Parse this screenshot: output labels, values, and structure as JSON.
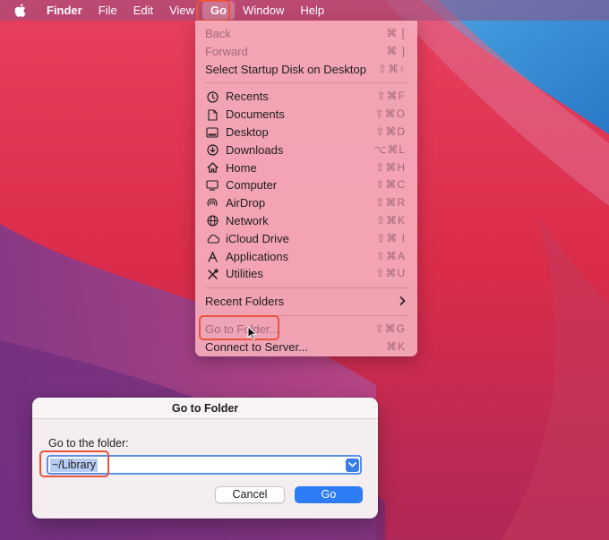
{
  "menubar": {
    "items": [
      {
        "label": "Finder"
      },
      {
        "label": "File"
      },
      {
        "label": "Edit"
      },
      {
        "label": "View"
      },
      {
        "label": "Go"
      },
      {
        "label": "Window"
      },
      {
        "label": "Help"
      }
    ]
  },
  "go_menu": {
    "back": {
      "label": "Back",
      "shortcut": "⌘ ["
    },
    "forward": {
      "label": "Forward",
      "shortcut": "⌘ ]"
    },
    "startup": {
      "label": "Select Startup Disk on Desktop",
      "shortcut": "⇧⌘↑"
    },
    "places": [
      {
        "label": "Recents",
        "shortcut": "⇧⌘F",
        "icon": "clock-icon"
      },
      {
        "label": "Documents",
        "shortcut": "⇧⌘O",
        "icon": "document-icon"
      },
      {
        "label": "Desktop",
        "shortcut": "⇧⌘D",
        "icon": "desktop-icon"
      },
      {
        "label": "Downloads",
        "shortcut": "⌥⌘L",
        "icon": "download-icon"
      },
      {
        "label": "Home",
        "shortcut": "⇧⌘H",
        "icon": "home-icon"
      },
      {
        "label": "Computer",
        "shortcut": "⇧⌘C",
        "icon": "computer-icon"
      },
      {
        "label": "AirDrop",
        "shortcut": "⇧⌘R",
        "icon": "airdrop-icon"
      },
      {
        "label": "Network",
        "shortcut": "⇧⌘K",
        "icon": "network-icon"
      },
      {
        "label": "iCloud Drive",
        "shortcut": "⇧⌘ I",
        "icon": "cloud-icon"
      },
      {
        "label": "Applications",
        "shortcut": "⇧⌘A",
        "icon": "applications-icon"
      },
      {
        "label": "Utilities",
        "shortcut": "⇧⌘U",
        "icon": "utilities-icon"
      }
    ],
    "recent_folders": {
      "label": "Recent Folders"
    },
    "go_to_folder": {
      "label": "Go to Folder...",
      "shortcut": "⇧⌘G"
    },
    "connect": {
      "label": "Connect to Server...",
      "shortcut": "⌘K"
    }
  },
  "dialog": {
    "title": "Go to Folder",
    "label": "Go to the folder:",
    "path_value": "~/Library",
    "cancel_label": "Cancel",
    "go_label": "Go"
  },
  "colors": {
    "accent": "#2e7cf6",
    "highlight_box": "#e8543f"
  }
}
